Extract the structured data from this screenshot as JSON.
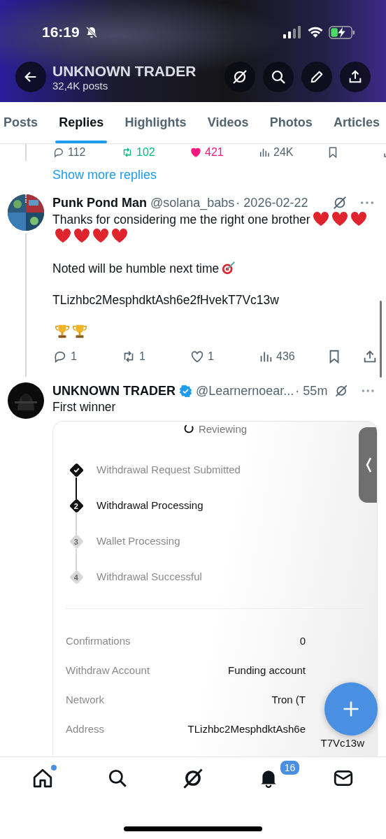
{
  "status_bar": {
    "time": "16:19"
  },
  "header": {
    "title": "UNKNOWN TRADER",
    "subtitle": "32,4K posts"
  },
  "tabs": [
    {
      "label": "Posts",
      "selected": false
    },
    {
      "label": "Replies",
      "selected": true
    },
    {
      "label": "Highlights",
      "selected": false
    },
    {
      "label": "Videos",
      "selected": false
    },
    {
      "label": "Photos",
      "selected": false
    },
    {
      "label": "Articles",
      "selected": false
    }
  ],
  "previous_post_stats": {
    "replies": "112",
    "reposts": "102",
    "likes": "421",
    "views": "24K",
    "reposted": true,
    "liked": true
  },
  "show_more": "Show more replies",
  "posts": [
    {
      "author": "Punk Pond Man",
      "verified": false,
      "handle": "@solana_babs",
      "time": "· 2026-02-22",
      "body": [
        [
          {
            "kind": "text",
            "text": "Thanks for considering me the right one brother"
          },
          {
            "kind": "heart"
          },
          {
            "kind": "heart"
          },
          {
            "kind": "heart"
          },
          {
            "kind": "heart"
          },
          {
            "kind": "heart"
          },
          {
            "kind": "heart"
          },
          {
            "kind": "heart"
          }
        ],
        [
          {
            "kind": "text",
            "text": "Noted will be humble next time"
          },
          {
            "kind": "target"
          }
        ],
        [
          {
            "kind": "text",
            "text": "TLizhbc2MesphdktAsh6e2fHvekT7Vc13w"
          }
        ],
        [
          {
            "kind": "trophy"
          },
          {
            "kind": "trophy"
          }
        ]
      ],
      "stats": {
        "replies": "1",
        "reposts": "1",
        "likes": "1",
        "views": "436",
        "reposted": false,
        "liked": false
      }
    },
    {
      "author": "UNKNOWN TRADER",
      "verified": true,
      "handle": "@Learnernoear...",
      "time": "· 55m",
      "body": [
        [
          {
            "kind": "text",
            "text": "First winner"
          }
        ]
      ],
      "card": {
        "status": "Reviewing",
        "steps": [
          {
            "label": "Withdrawal Request Submitted",
            "completed": true,
            "active": false
          },
          {
            "label": "Withdrawal Processing",
            "completed": false,
            "active": true,
            "number": "2"
          },
          {
            "label": "Wallet Processing",
            "completed": false,
            "active": false,
            "number": "3"
          },
          {
            "label": "Withdrawal Successful",
            "completed": false,
            "active": false,
            "number": "4"
          }
        ],
        "details": [
          {
            "label": "Confirmations",
            "value": [
              "0"
            ]
          },
          {
            "label": "Withdraw Account",
            "value": [
              "Funding account"
            ]
          },
          {
            "label": "Network",
            "value": [
              "Tron (T"
            ]
          },
          {
            "label": "Address",
            "value": [
              "TLizhbc2MesphdktAsh6e",
              "T7Vc13w"
            ]
          }
        ]
      }
    }
  ],
  "bottom_nav": {
    "notifications_badge": "16",
    "home_unread": true
  }
}
